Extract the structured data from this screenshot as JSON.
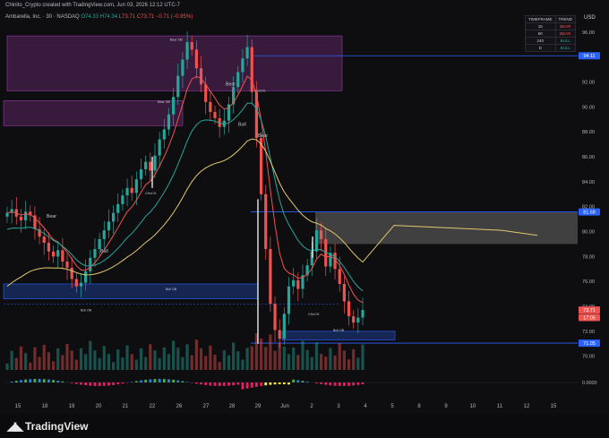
{
  "header": {
    "credit": "Chinito_Crypto created with TradingView.com, Jun 03, 2026 12:12 UTC-7",
    "symbol": "Ambarella, Inc. · 30 · NASDAQ",
    "ohlc": {
      "o": "O74.33",
      "h": "H74.34",
      "l": "L73.71",
      "c": "C73.71",
      "chg": "−0.71 (−0.95%)"
    }
  },
  "currency": "USD",
  "trend_table": {
    "headers": [
      "TIMEFRAME",
      "TREND"
    ],
    "rows": [
      [
        "15",
        "BEAR"
      ],
      [
        "60",
        "BEAR"
      ],
      [
        "240",
        "BULL"
      ],
      [
        "D",
        "BULL"
      ]
    ]
  },
  "brand": "TradingView",
  "colors": {
    "bull": "#26a69a",
    "bear": "#ef5350",
    "ma_yellow": "#e2c86b",
    "level_blue": "#2962ff",
    "bear_zone": "#6a2a73",
    "bull_zone": "#1d3a8a"
  },
  "chart_data": {
    "type": "candlestick",
    "y_axis_ticks": [
      70,
      72,
      74,
      76,
      78,
      80,
      82,
      84,
      86,
      88,
      90,
      92,
      94,
      96
    ],
    "y_axis_range": [
      68.9,
      97
    ],
    "x_axis_labels": [
      "15",
      "18",
      "19",
      "20",
      "21",
      "22",
      "26",
      "27",
      "28",
      "29",
      "Jun",
      "2",
      "3",
      "4",
      "5",
      "8",
      "9",
      "10",
      "11",
      "12",
      "15"
    ],
    "price_markers": [
      {
        "label": "94.11",
        "value": 94.11,
        "color": "#2962ff"
      },
      {
        "label": "81.58",
        "value": 81.58,
        "color": "#2962ff"
      },
      {
        "label": "73.71",
        "value": 73.71,
        "color": "#ef5350"
      },
      {
        "label": "17:05",
        "value": 73.1,
        "color": "#ef5350"
      },
      {
        "label": "71.05",
        "value": 71.05,
        "color": "#2962ff"
      }
    ],
    "oscillator_tick": "0.0000",
    "annotations": [
      "Bear",
      "Bull",
      "Bear",
      "Bull",
      "Bear",
      "Bull OB",
      "Bear OB",
      "Bear OB",
      "Bull OB",
      "Bull OB",
      "CHoCH",
      "CHoCH",
      "CHoCH"
    ],
    "closes": [
      81.5,
      81.8,
      81.2,
      80.9,
      81.6,
      81.3,
      80.2,
      79.6,
      79.1,
      78.4,
      78.0,
      78.5,
      77.6,
      77.1,
      76.2,
      75.6,
      75.9,
      76.8,
      77.9,
      78.6,
      79.4,
      80.1,
      80.8,
      81.5,
      82.2,
      82.9,
      83.5,
      83.1,
      84.2,
      85.0,
      85.6,
      84.9,
      86.1,
      87.4,
      88.2,
      89.4,
      90.8,
      92.5,
      93.8,
      95.2,
      94.6,
      93.1,
      91.8,
      90.4,
      89.6,
      89.1,
      88.4,
      88.9,
      90.2,
      91.6,
      92.8,
      93.9,
      94.8,
      91.2,
      87.5,
      83.0,
      78.6,
      74.2,
      72.1,
      71.4,
      73.4,
      75.6,
      76.1,
      75.4,
      76.5,
      77.3,
      78.4,
      80.1,
      79.4,
      77.2,
      78.3,
      77.0,
      75.8,
      74.4,
      73.2,
      72.7,
      73.1,
      73.71
    ],
    "series": [
      {
        "name": "EMA fast",
        "color": "#ef5350"
      },
      {
        "name": "EMA slow",
        "color": "#26a69a"
      },
      {
        "name": "MA",
        "color": "#e2c86b"
      }
    ]
  }
}
